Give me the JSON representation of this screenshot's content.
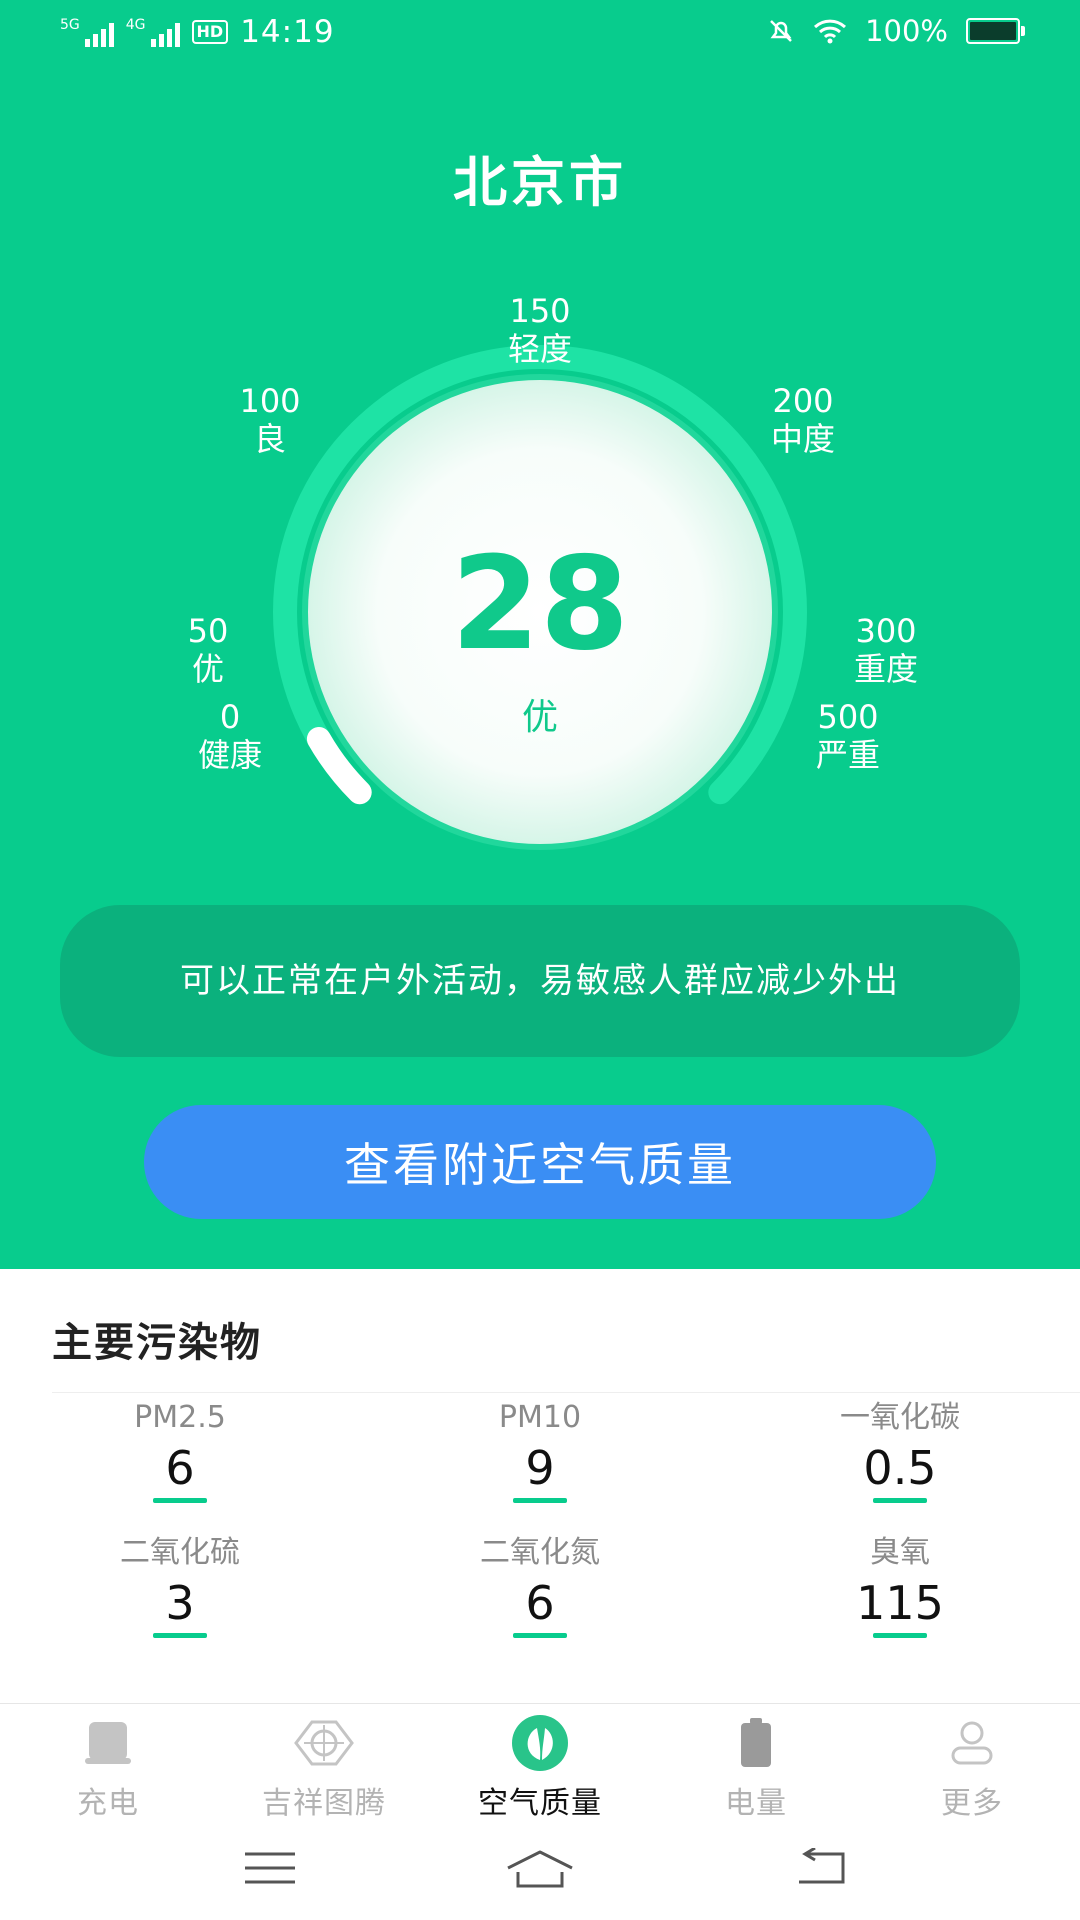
{
  "status_bar": {
    "net1": "5G",
    "net2": "4G",
    "hd": "HD",
    "time": "14:19",
    "battery": "100%"
  },
  "city": "北京市",
  "gauge": {
    "value": "28",
    "level": "优",
    "progress_fraction": 0.056,
    "scale": [
      {
        "value": "0",
        "label": "健康"
      },
      {
        "value": "50",
        "label": "优"
      },
      {
        "value": "100",
        "label": "良"
      },
      {
        "value": "150",
        "label": "轻度"
      },
      {
        "value": "200",
        "label": "中度"
      },
      {
        "value": "300",
        "label": "重度"
      },
      {
        "value": "500",
        "label": "严重"
      }
    ]
  },
  "advice": "可以正常在户外活动，易敏感人群应减少外出",
  "nearby_button": "查看附近空气质量",
  "pollutants": {
    "title": "主要污染物",
    "items": [
      {
        "name": "PM2.5",
        "value": "6"
      },
      {
        "name": "PM10",
        "value": "9"
      },
      {
        "name": "一氧化碳",
        "value": "0.5"
      },
      {
        "name": "二氧化硫",
        "value": "3"
      },
      {
        "name": "二氧化氮",
        "value": "6"
      },
      {
        "name": "臭氧",
        "value": "115"
      }
    ]
  },
  "tabs": [
    {
      "label": "充电",
      "icon": "charger-icon"
    },
    {
      "label": "吉祥图腾",
      "icon": "totem-icon"
    },
    {
      "label": "空气质量",
      "icon": "leaf-icon",
      "active": true
    },
    {
      "label": "电量",
      "icon": "battery-icon"
    },
    {
      "label": "更多",
      "icon": "person-icon"
    }
  ],
  "colors": {
    "primary_green": "#08cc8d",
    "advice_bg": "#0bb17d",
    "button_blue": "#3a8ef4"
  }
}
